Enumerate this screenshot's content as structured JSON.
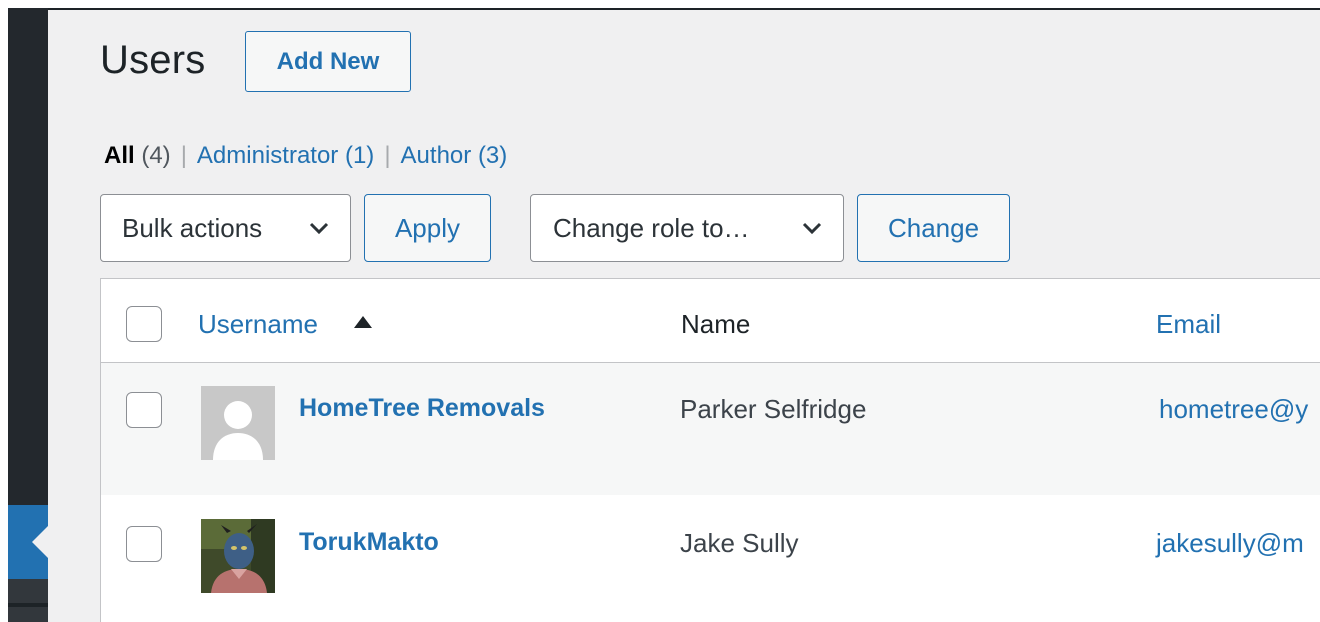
{
  "page": {
    "title": "Users",
    "add_new_label": "Add New"
  },
  "filters": {
    "all": {
      "label": "All",
      "count": "(4)"
    },
    "administrator": {
      "label": "Administrator",
      "count": "(1)"
    },
    "author": {
      "label": "Author",
      "count": "(3)"
    },
    "separator": "|"
  },
  "actions": {
    "bulk_actions_label": "Bulk actions",
    "apply_label": "Apply",
    "change_role_label": "Change role to…",
    "change_label": "Change"
  },
  "table": {
    "columns": {
      "username": "Username",
      "name": "Name",
      "email": "Email"
    },
    "sort_indicator": "ascending",
    "rows": [
      {
        "username": "HomeTree Removals",
        "name": "Parker Selfridge",
        "email": "hometree@y",
        "avatar": "default-avatar"
      },
      {
        "username": "TorukMakto",
        "name": "Jake Sully",
        "email": "jakesully@m",
        "avatar": "photo-avatar"
      }
    ]
  },
  "colors": {
    "accent": "#2271b1",
    "sidebar": "#23282d",
    "background": "#f0f0f1"
  }
}
